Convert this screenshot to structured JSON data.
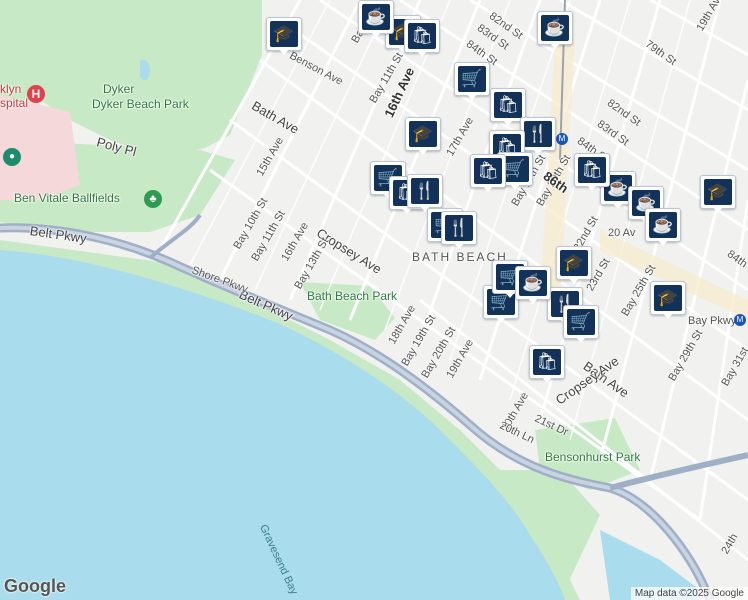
{
  "map": {
    "neighborhood": "BATH BEACH",
    "parks": [
      "Dyker Beach Park",
      "Ben Vitale Ballfields",
      "Bath Beach Park",
      "Bensonhurst Park"
    ],
    "water": "Gravesend Bay",
    "hospital_label": "klyn\nspital",
    "streets": {
      "bath_ave_w": "Bath Ave",
      "bath_ave_e": "Bath Ave",
      "poly_pl": "Poly Pl",
      "cropsey_w": "Cropsey Ave",
      "cropsey_e": "Cropsey Ave",
      "belt_w": "Belt Pkwy",
      "belt_mid": "Belt Pkwy",
      "shore": "Shore Pkwy",
      "benson": "Benson Ave",
      "s15": "15th Ave",
      "s16": "16th Ave",
      "s16top": "16th Ave",
      "s17": "17th Ave",
      "s18": "18th Ave",
      "s19": "19th Ave",
      "s20": "20th Ave",
      "s20a": "20 Av",
      "b10": "Bay 10th St",
      "b10top": "Bay 10th St",
      "b11": "Bay 11th St",
      "b11top": "Bay 11th St",
      "b13": "Bay 13th St",
      "b19": "Bay 19th St",
      "b19b": "Bay 19th St",
      "b20": "Bay 20th St",
      "b20b": "Bay 20th St",
      "s20ln": "20th Ln",
      "s21dr": "21st Dr",
      "s22": "22nd St",
      "s23": "23rd St",
      "b25": "Bay 25th St",
      "b29": "Bay 29th St",
      "b31": "Bay 31st",
      "s24": "24th",
      "s79": "79th St",
      "s82": "82nd St",
      "s82b": "82nd St",
      "s83": "83rd St",
      "s83b": "83rd St",
      "s84": "84th St",
      "s84b": "84th St",
      "s86": "86th",
      "s19av": "19th Ave",
      "bay_pkwy": "Bay Pkwy",
      "s84e": "84th"
    },
    "pins": [
      {
        "type": "school",
        "icon": "🎓"
      },
      {
        "type": "coffee",
        "icon": "☕"
      },
      {
        "type": "school",
        "icon": "🎓"
      },
      {
        "type": "shop",
        "icon": "🛍"
      },
      {
        "type": "coffee",
        "icon": "☕"
      },
      {
        "type": "grocery",
        "icon": "🛒"
      },
      {
        "type": "shop",
        "icon": "🛍"
      },
      {
        "type": "school",
        "icon": "🎓"
      },
      {
        "type": "restaurant",
        "icon": "🍴"
      },
      {
        "type": "shop",
        "icon": "🛍"
      },
      {
        "type": "grocery",
        "icon": "🛒"
      },
      {
        "type": "shop",
        "icon": "🛍"
      },
      {
        "type": "grocery",
        "icon": "🛒"
      },
      {
        "type": "shop",
        "icon": "🛍"
      },
      {
        "type": "restaurant",
        "icon": "🍴"
      },
      {
        "type": "grocery",
        "icon": "🛒"
      },
      {
        "type": "restaurant",
        "icon": "🍴"
      },
      {
        "type": "coffee",
        "icon": "☕"
      },
      {
        "type": "school",
        "icon": "🎓"
      },
      {
        "type": "coffee",
        "icon": "☕"
      },
      {
        "type": "coffee",
        "icon": "☕"
      },
      {
        "type": "school",
        "icon": "🎓"
      },
      {
        "type": "grocery",
        "icon": "🛒"
      },
      {
        "type": "restaurant",
        "icon": "🍴"
      },
      {
        "type": "grocery",
        "icon": "🛒"
      },
      {
        "type": "grocery",
        "icon": "🛒"
      },
      {
        "type": "shop",
        "icon": "🛍"
      },
      {
        "type": "school",
        "icon": "🎓"
      },
      {
        "type": "shop",
        "icon": "🛍"
      },
      {
        "type": "coffee",
        "icon": "☕"
      }
    ],
    "colors": {
      "water": "#a9dcec",
      "park": "#c8e9c5",
      "highway": "#9fb0c6",
      "background": "#f1f1ef",
      "pin": "#13325a"
    },
    "logo": "Google",
    "attribution": "Map data ©2025 Google"
  }
}
